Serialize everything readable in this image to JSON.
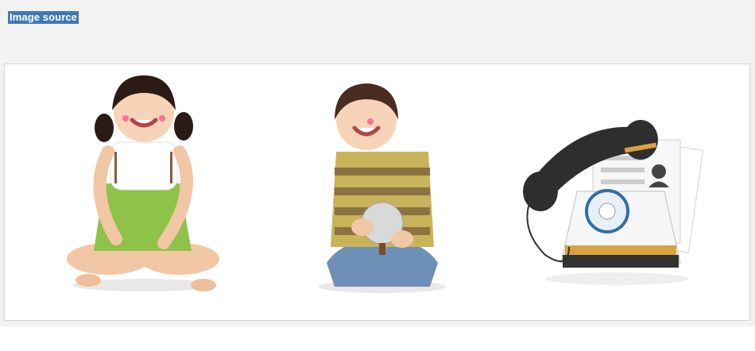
{
  "header": {
    "image_source_label": "Image source"
  },
  "gallery": {
    "items": [
      {
        "name": "girl-sitting-image"
      },
      {
        "name": "boy-with-globe-image"
      },
      {
        "name": "telephone-contact-image"
      }
    ]
  },
  "colors": {
    "label_background": "#3f78b7",
    "label_text": "#ffffff",
    "page_background": "#f2f2f2",
    "panel_background": "#ffffff",
    "panel_border": "#d4d4d4"
  }
}
